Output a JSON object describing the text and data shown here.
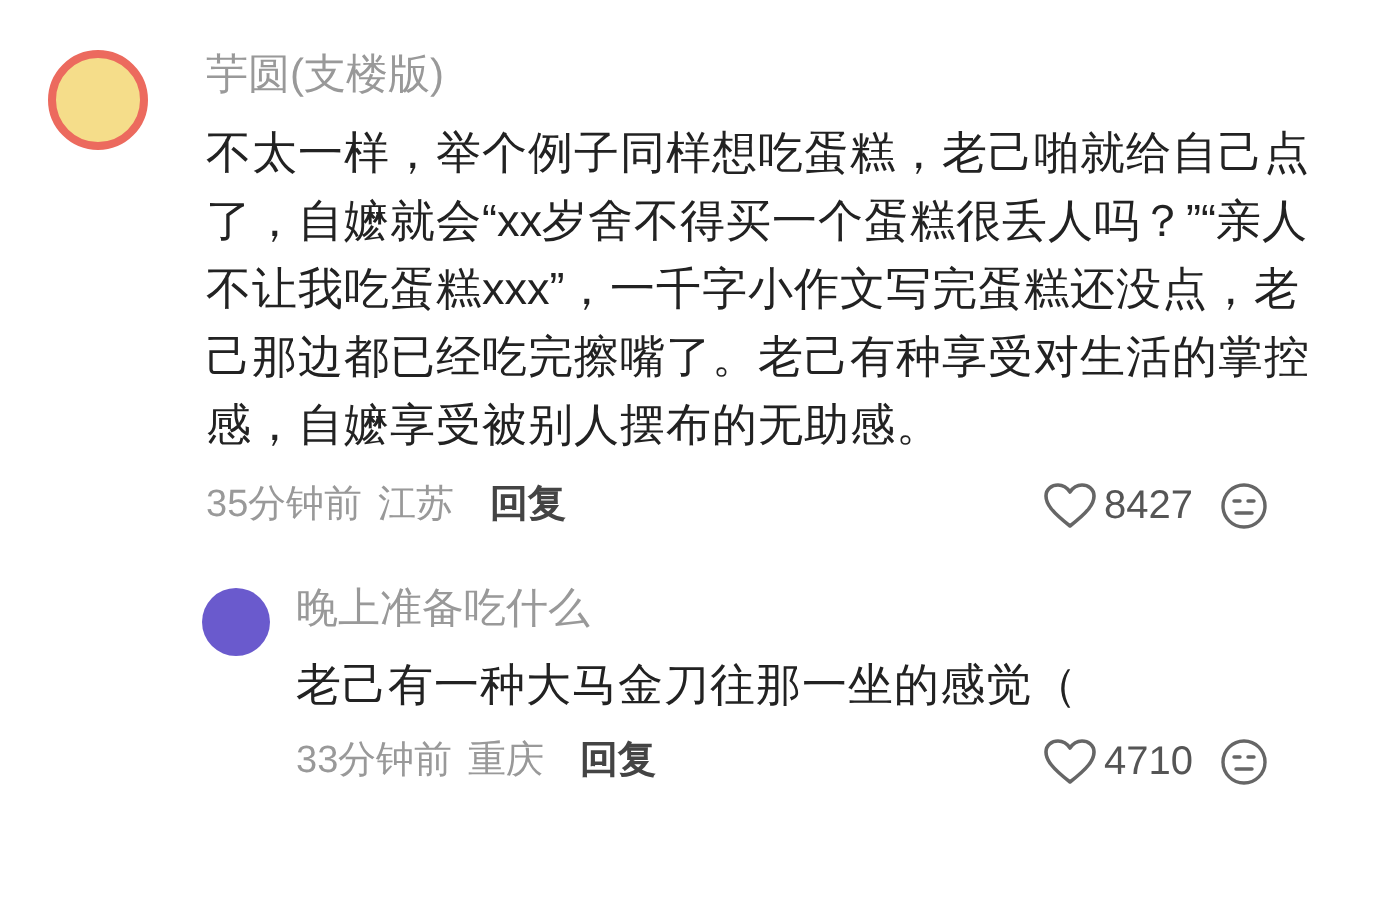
{
  "comment": {
    "author": "芋圆(支楼版)",
    "text": "不太一样，举个例子同样想吃蛋糕，老己啪就给自己点了，自嬷就会“xx岁舍不得买一个蛋糕很丢人吗？”“亲人不让我吃蛋糕xxx”，一千字小作文写完蛋糕还没点，老己那边都已经吃完擦嘴了。老己有种享受对生活的掌控感，自嬷享受被别人摆布的无助感。",
    "time": "35分钟前",
    "location": "江苏",
    "reply_label": "回复",
    "likes": "8427",
    "replies": [
      {
        "author": "晚上准备吃什么",
        "text": "老己有一种大马金刀往那一坐的感觉（",
        "time": "33分钟前",
        "location": "重庆",
        "reply_label": "回复",
        "likes": "4710"
      }
    ]
  }
}
